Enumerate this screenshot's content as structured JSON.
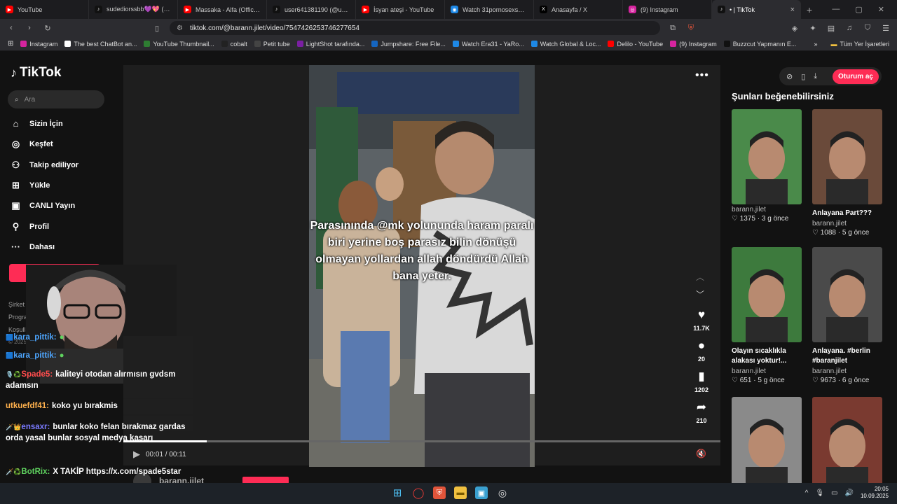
{
  "tabs": [
    {
      "title": "YouTube",
      "color": "#ff0000",
      "glyph": "▶"
    },
    {
      "title": "sudediorssbb💜💖 (@su...",
      "color": "#111111",
      "glyph": "♪"
    },
    {
      "title": "Massaka - Alfa (Official vid...",
      "color": "#ff0000",
      "glyph": "▶"
    },
    {
      "title": "user641381190 (@user64...",
      "color": "#111111",
      "glyph": "♪"
    },
    {
      "title": "İsyan ateşi - YouTube",
      "color": "#ff0000",
      "glyph": "▶"
    },
    {
      "title": "Watch 31pornosexspades...",
      "color": "#1e88e5",
      "glyph": "◉"
    },
    {
      "title": "Anasayfa / X",
      "color": "#000000",
      "glyph": "X"
    },
    {
      "title": "(9) Instagram",
      "color": "#d6249f",
      "glyph": "◎"
    },
    {
      "title": "• | TikTok",
      "color": "#111111",
      "glyph": "♪",
      "active": true
    }
  ],
  "toolbar": {
    "url": "tiktok.com/@barann.jilet/video/7547426253746277654"
  },
  "bookmarks": [
    {
      "label": "Instagram",
      "color": "#d6249f"
    },
    {
      "label": "The best ChatBot an...",
      "color": "#ffffff"
    },
    {
      "label": "YouTube Thumbnail...",
      "color": "#2e7d32"
    },
    {
      "label": "cobalt",
      "color": "#222222"
    },
    {
      "label": "Petit tube",
      "color": "#444444"
    },
    {
      "label": "LightShot tarafında...",
      "color": "#7b1fa2"
    },
    {
      "label": "Jumpshare: Free File...",
      "color": "#1565c0"
    },
    {
      "label": "Watch Era31 - YaRo...",
      "color": "#1e88e5"
    },
    {
      "label": "Watch Global & Loc...",
      "color": "#1e88e5"
    },
    {
      "label": "Delilo - YouTube",
      "color": "#ff0000"
    },
    {
      "label": "(9) Instagram",
      "color": "#d6249f"
    },
    {
      "label": "Buzzcut Yapmanın E...",
      "color": "#111111"
    }
  ],
  "bookmarks_folder": "Tüm Yer İşaretleri",
  "sidebar": {
    "logo": "TikTok",
    "search_placeholder": "Ara",
    "items": [
      {
        "label": "Sizin İçin",
        "icon": "home-icon",
        "glyph": "⌂"
      },
      {
        "label": "Keşfet",
        "icon": "compass-icon",
        "glyph": "◎"
      },
      {
        "label": "Takip ediliyor",
        "icon": "following-icon",
        "glyph": "⚇"
      },
      {
        "label": "Yükle",
        "icon": "upload-icon",
        "glyph": "⊞"
      },
      {
        "label": "CANLI Yayın",
        "icon": "live-icon",
        "glyph": "▣"
      },
      {
        "label": "Profil",
        "icon": "profile-icon",
        "glyph": "⚲"
      },
      {
        "label": "Dahası",
        "icon": "more-icon",
        "glyph": "···"
      }
    ],
    "footer": [
      "Şirket",
      "Program",
      "Koşullar ve Politikalar"
    ],
    "copyright": "© 2025 TikTok"
  },
  "chat": [
    {
      "user": "kara_pittik:",
      "text": "",
      "color": "#4da6ff",
      "badges": "🟦"
    },
    {
      "user": "kara_pittik:",
      "text": "",
      "color": "#4da6ff",
      "badges": "🟦"
    },
    {
      "user": "Spade5:",
      "text": "kaliteyi otodan alırmısın gvdsm adamsın",
      "color": "#ff4d4d",
      "badges": "🎙️♻️"
    },
    {
      "user": "utkuefdf41:",
      "text": "koko yu bırakmis",
      "color": "#ffb14d",
      "badges": ""
    },
    {
      "user": "ensaxr:",
      "text": "bunlar koko felan bırakmaz gardas orda yasal bunlar sosyal medya kaşarı",
      "color": "#7a7aff",
      "badges": "🗡️👑"
    },
    {
      "user": "BotRix:",
      "text": "X TAKİP https://x.com/spade5star",
      "color": "#5fd35f",
      "badges": "🗡️♻️"
    }
  ],
  "video": {
    "caption": "Parasınında @mk yolununda haram paralı biri yerine boş parasız bilin dönüşü olmayan yollardan allah döndürdü Allah bana yeter.",
    "time": "00:01 / 00:11",
    "progress": 0.14,
    "author": "barann.jilet",
    "actions": [
      {
        "icon": "heart-icon",
        "glyph": "♥",
        "count": "11.7K"
      },
      {
        "icon": "comment-icon",
        "glyph": "●",
        "count": "20"
      },
      {
        "icon": "bookmark-icon",
        "glyph": "▮",
        "count": "1202"
      },
      {
        "icon": "share-icon",
        "glyph": "➦",
        "count": "210"
      }
    ]
  },
  "right": {
    "login": "Oturum aç",
    "title": "Şunları beğenebilirsiniz",
    "cards": [
      {
        "title": "",
        "author": "barann.jilet",
        "likes": "1375",
        "age": "3 g önce",
        "bg": "#4a8a4a"
      },
      {
        "title": "Anlayana Part???",
        "author": "barann.jilet",
        "likes": "1088",
        "age": "5 g önce",
        "bg": "#6a4a3a"
      },
      {
        "title": "Olayın sıcaklıkla alakası yoktur!...",
        "author": "barann.jilet",
        "likes": "651",
        "age": "5 g önce",
        "bg": "#3d7a3d"
      },
      {
        "title": "Anlayana. #berlin #baranjilet",
        "author": "barann.jilet",
        "likes": "9673",
        "age": "6 g önce",
        "bg": "#4a4a4a"
      },
      {
        "title": "",
        "author": "",
        "likes": "",
        "age": "",
        "bg": "#8a8a8a"
      },
      {
        "title": "",
        "author": "",
        "likes": "",
        "age": "",
        "bg": "#7a3a30"
      }
    ]
  },
  "taskbar": {
    "time": "20:05",
    "date": "10.09.2025"
  }
}
